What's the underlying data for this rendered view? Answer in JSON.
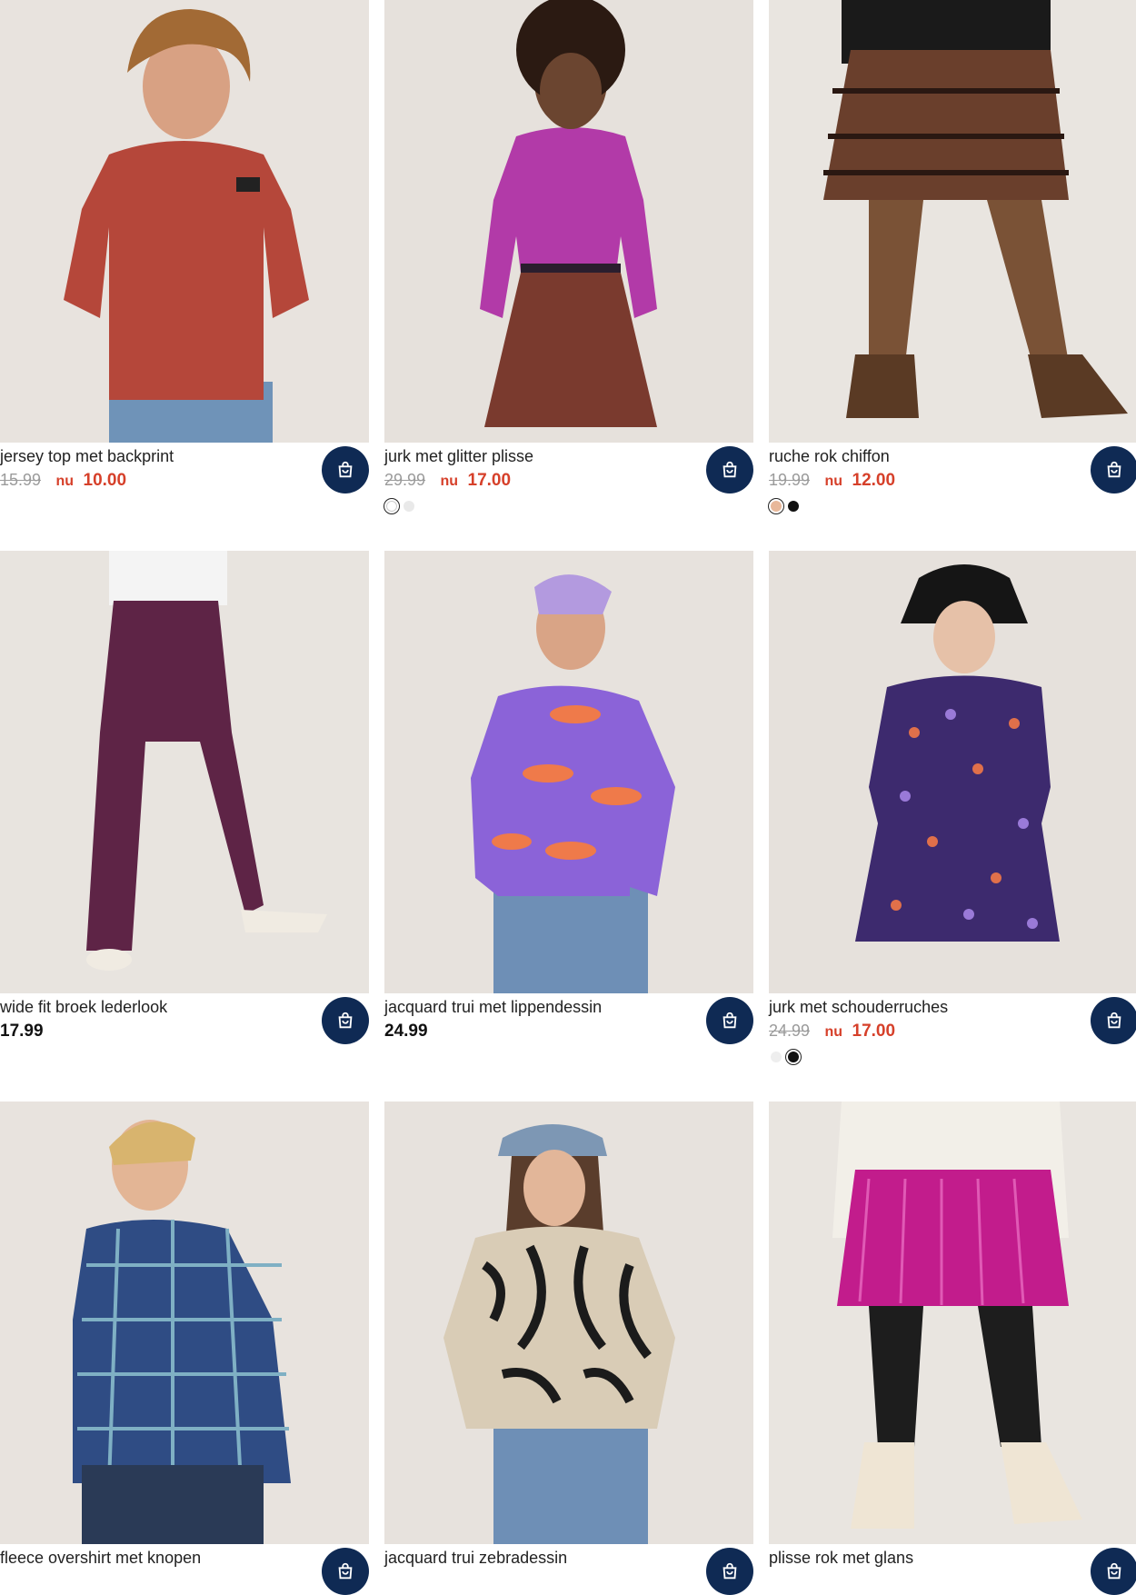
{
  "products": [
    {
      "title": "jersey top met backprint",
      "old_price": "15.99",
      "nu": "nu",
      "new_price": "10.00",
      "colors": []
    },
    {
      "title": "jurk met glitter plisse",
      "old_price": "29.99",
      "nu": "nu",
      "new_price": "17.00",
      "colors": [
        "#ffffff",
        "#e9e9e9"
      ]
    },
    {
      "title": "ruche rok chiffon",
      "old_price": "19.99",
      "nu": "nu",
      "new_price": "12.00",
      "colors": [
        "#e8b89a",
        "#111111"
      ]
    },
    {
      "title": "wide fit broek lederlook",
      "price": "17.99",
      "colors": []
    },
    {
      "title": "jacquard trui met lippendessin",
      "price": "24.99",
      "colors": []
    },
    {
      "title": "jurk met schouderruches",
      "old_price": "24.99",
      "nu": "nu",
      "new_price": "17.00",
      "colors": [
        "#eeeeee",
        "#111111"
      ]
    },
    {
      "title": "fleece overshirt met knopen",
      "colors": []
    },
    {
      "title": "jacquard trui zebradessin",
      "colors": []
    },
    {
      "title": "plisse rok met glans",
      "colors": []
    }
  ],
  "colors": {
    "cart_button": "#0f2a54",
    "sale": "#d6402a",
    "old_price": "#9b9b9b",
    "image_background": "#e8e3de"
  },
  "icons": {
    "cart": "shopping-bag-icon"
  }
}
